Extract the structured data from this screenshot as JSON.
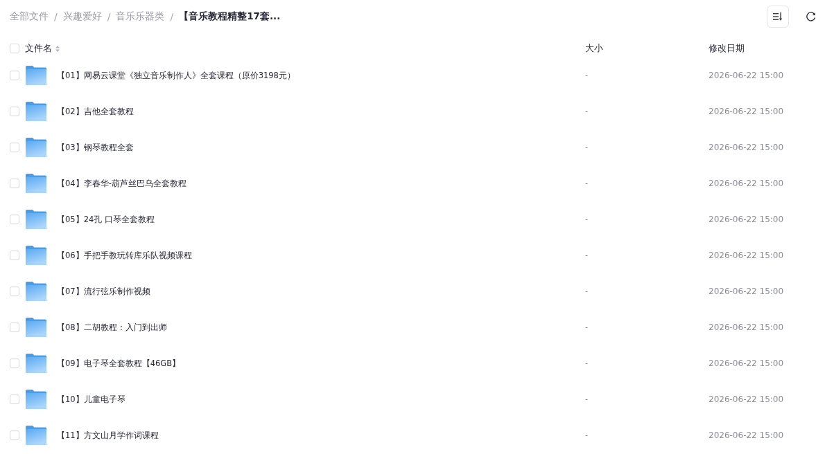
{
  "breadcrumb": [
    {
      "label": "全部文件",
      "current": false,
      "separator": "/"
    },
    {
      "label": "兴趣爱好",
      "current": false,
      "separator": "/"
    },
    {
      "label": "音乐乐器类",
      "current": false,
      "separator": "/"
    },
    {
      "label": "【音乐教程精整17套...",
      "current": true
    }
  ],
  "table": {
    "select_all_checked": false,
    "columns": [
      {
        "label": "文件名",
        "sortable": true
      },
      {
        "label": "大小",
        "sortable": false
      },
      {
        "label": "修改日期",
        "sortable": false
      }
    ],
    "rows": [
      {
        "name": "【01】网易云课堂《独立音乐制作人》全套课程（原价3198元）",
        "size": "-",
        "modified": "2026-06-22 15:00",
        "checked": false
      },
      {
        "name": "【02】吉他全套教程",
        "size": "-",
        "modified": "2026-06-22 15:00",
        "checked": false
      },
      {
        "name": "【03】钢琴教程全套",
        "size": "-",
        "modified": "2026-06-22 15:00",
        "checked": false
      },
      {
        "name": "【04】李春华-葫芦丝巴乌全套教程",
        "size": "-",
        "modified": "2026-06-22 15:00",
        "checked": false
      },
      {
        "name": "【05】24孔 口琴全套教程",
        "size": "-",
        "modified": "2026-06-22 15:00",
        "checked": false
      },
      {
        "name": "【06】手把手教玩转库乐队视频课程",
        "size": "-",
        "modified": "2026-06-22 15:00",
        "checked": false
      },
      {
        "name": "【07】流行弦乐制作视频",
        "size": "-",
        "modified": "2026-06-22 15:00",
        "checked": false
      },
      {
        "name": "【08】二胡教程：入门到出师",
        "size": "-",
        "modified": "2026-06-22 15:00",
        "checked": false
      },
      {
        "name": "【09】电子琴全套教程【46GB】",
        "size": "-",
        "modified": "2026-06-22 15:00",
        "checked": false
      },
      {
        "name": "【10】儿童电子琴",
        "size": "-",
        "modified": "2026-06-22 15:00",
        "checked": false
      },
      {
        "name": "【11】方文山月学作词课程",
        "size": "-",
        "modified": "2026-06-22 15:00",
        "checked": false
      }
    ]
  }
}
